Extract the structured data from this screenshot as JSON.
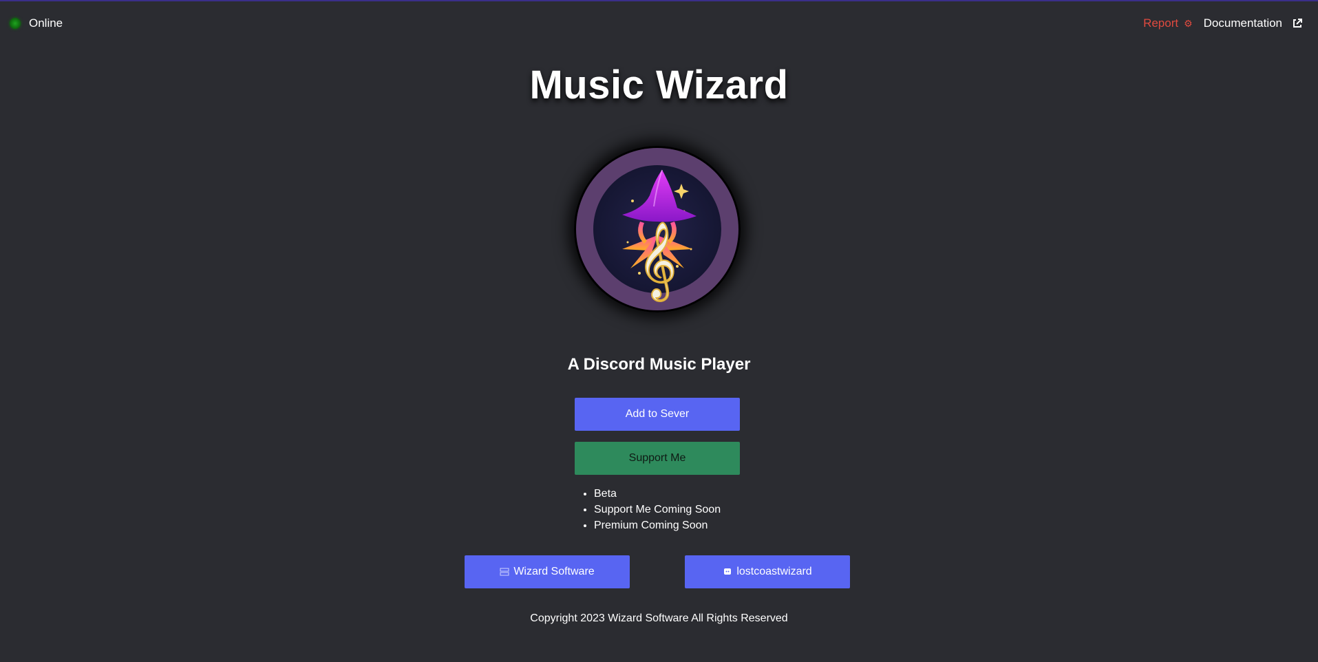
{
  "status": {
    "label": "Online",
    "color": "#0f6b0f"
  },
  "nav": {
    "report_label": "Report",
    "report_icon": "bug-icon",
    "docs_label": "Documentation",
    "docs_icon": "external-link-icon"
  },
  "hero": {
    "title": "Music Wizard",
    "logo_icon": "wizard-hat-treble-clef-logo",
    "subtitle": "A Discord Music Player"
  },
  "actions": {
    "add_label": "Add to Sever",
    "support_label": "Support Me"
  },
  "notes": [
    "Beta",
    "Support Me Coming Soon",
    "Premium Coming Soon"
  ],
  "links": {
    "wizard_label": "Wizard Software",
    "wizard_icon": "server-icon",
    "discord_label": "lostcoastwizard",
    "discord_icon": "discord-icon"
  },
  "footer": {
    "copyright": "Copyright 2023 Wizard Software All Rights Reserved"
  },
  "colors": {
    "background": "#2b2c31",
    "primary_button": "#5865f2",
    "support_button": "#2e8a5c",
    "report": "#e04a3f"
  }
}
